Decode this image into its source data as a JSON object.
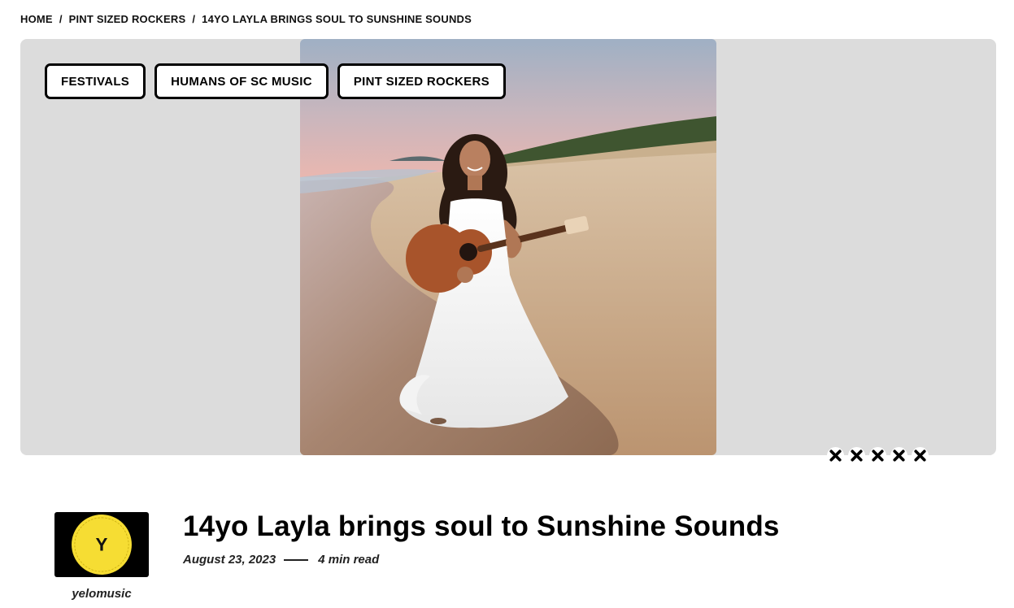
{
  "breadcrumb": {
    "home": "HOME",
    "sep1": "/",
    "category": "PINT SIZED ROCKERS",
    "sep2": "/",
    "current": "14YO LAYLA BRINGS SOUL TO SUNSHINE SOUNDS"
  },
  "tags": [
    {
      "label": "FESTIVALS"
    },
    {
      "label": "HUMANS OF SC MUSIC"
    },
    {
      "label": "PINT SIZED ROCKERS"
    }
  ],
  "hero": {
    "background": "#dcdcdc",
    "photo": "girl in white dress holding acoustic guitar on beach at sunset"
  },
  "rating": {
    "icons": [
      "close-icon",
      "close-icon",
      "close-icon",
      "close-icon",
      "close-icon"
    ]
  },
  "author": {
    "avatar_letter": "Y",
    "avatar_color": "#f6dd33",
    "name": "yelomusic"
  },
  "article": {
    "title": "14yo Layla brings soul to Sunshine Sounds",
    "date": "August 23, 2023",
    "read_time": "4 min read"
  }
}
